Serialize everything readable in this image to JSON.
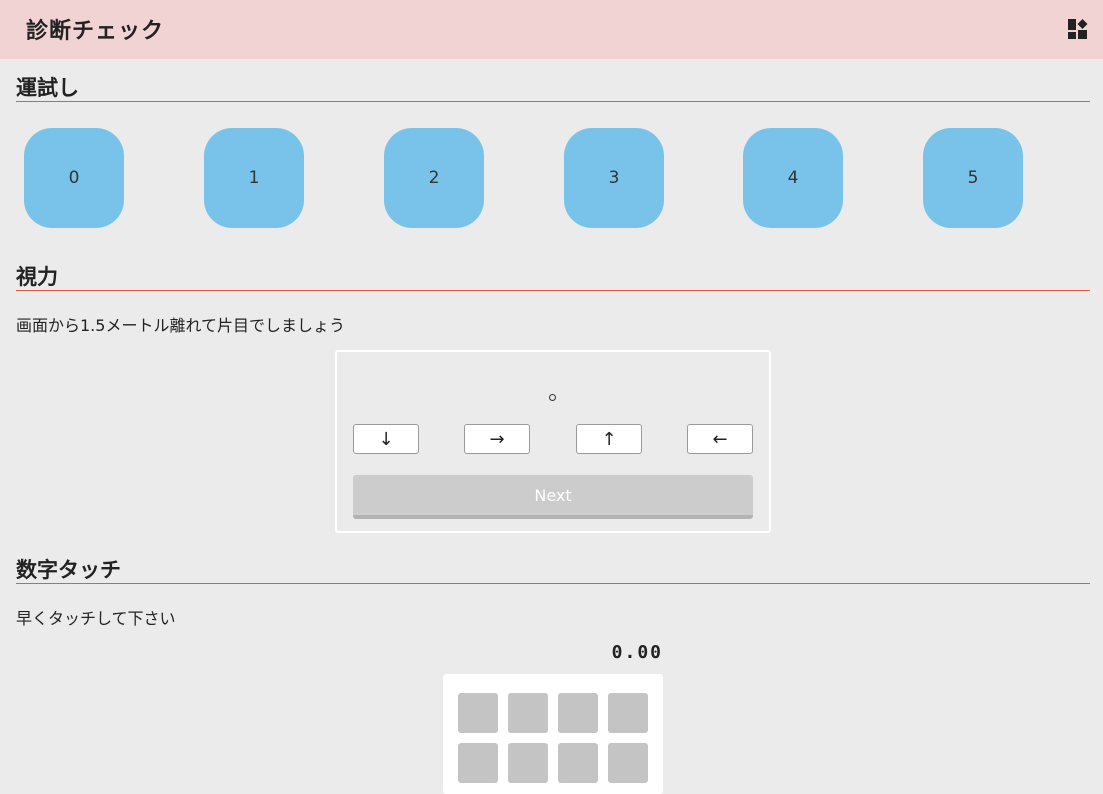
{
  "header": {
    "title": "診断チェック",
    "menu_icon": "dashboard-shapes-icon"
  },
  "fortune": {
    "title": "運試し",
    "buttons": [
      "0",
      "1",
      "2",
      "3",
      "4",
      "5"
    ],
    "button_color": "#79c3ea"
  },
  "vision": {
    "title": "視力",
    "description": "画面から1.5メートル離れて片目でしましょう",
    "target_icon": "landolt-ring-icon",
    "arrows": [
      "↓",
      "→",
      "↑",
      "←"
    ],
    "next_label": "Next"
  },
  "number_touch": {
    "title": "数字タッチ",
    "description": "早くタッチして下さい",
    "timer": "0.00",
    "tile_count": 8
  },
  "colors": {
    "header_bg": "#f2d3d4",
    "rule": "#e15a4a",
    "page_bg": "#ebebeb"
  }
}
